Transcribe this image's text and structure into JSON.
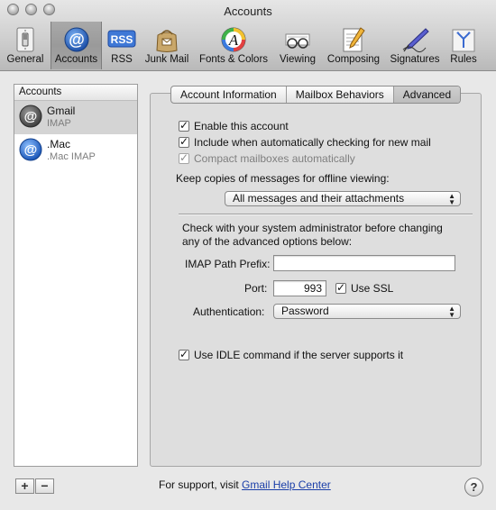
{
  "window": {
    "title": "Accounts"
  },
  "toolbar": {
    "items": [
      {
        "label": "General",
        "icon": "light-switch-icon"
      },
      {
        "label": "Accounts",
        "icon": "at-sign-icon"
      },
      {
        "label": "RSS",
        "icon": "rss-icon"
      },
      {
        "label": "Junk Mail",
        "icon": "junk-bag-icon"
      },
      {
        "label": "Fonts & Colors",
        "icon": "fonts-colors-icon"
      },
      {
        "label": "Viewing",
        "icon": "glasses-icon"
      },
      {
        "label": "Composing",
        "icon": "pencil-notepad-icon"
      },
      {
        "label": "Signatures",
        "icon": "fountain-pen-icon"
      },
      {
        "label": "Rules",
        "icon": "rules-arrows-icon"
      }
    ],
    "selected": "Accounts"
  },
  "accounts": {
    "header": "Accounts",
    "items": [
      {
        "name": "Gmail",
        "type": "IMAP"
      },
      {
        "name": ".Mac",
        "type": ".Mac IMAP"
      }
    ],
    "add_label": "+",
    "remove_label": "−"
  },
  "tabs": [
    {
      "label": "Account Information"
    },
    {
      "label": "Mailbox Behaviors"
    },
    {
      "label": "Advanced"
    }
  ],
  "advanced": {
    "enable_account": "Enable this account",
    "include_checking": "Include when automatically checking for new mail",
    "compact_mailboxes": "Compact mailboxes automatically",
    "keep_copies_label": "Keep copies of messages for offline viewing:",
    "keep_copies_value": "All messages and their attachments",
    "admin_note_1": "Check with your system administrator before changing",
    "admin_note_2": "any of the advanced options below:",
    "imap_prefix_label": "IMAP Path Prefix:",
    "imap_prefix_value": "",
    "port_label": "Port:",
    "port_value": "993",
    "use_ssl_label": "Use SSL",
    "authentication_label": "Authentication:",
    "authentication_value": "Password",
    "idle_label": "Use IDLE command if the server supports it"
  },
  "footer": {
    "support_prefix": "For support, visit",
    "support_link": "Gmail Help Center",
    "help_label": "?"
  }
}
